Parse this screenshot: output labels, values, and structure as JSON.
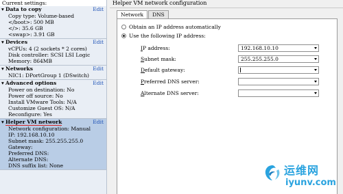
{
  "left_panel": {
    "header": "Current settings:",
    "edit_label": "Edit",
    "sections": [
      {
        "title": "Data to copy",
        "lines": [
          "Copy type: Volume-based",
          "</boot>: 500 MB",
          "</>: 35.6 GB",
          "<swap>: 3.91 GB"
        ]
      },
      {
        "title": "Devices",
        "lines": [
          "vCPUs: 4 (2 sockets * 2 cores)",
          "Disk controller: SCSI LSI Logic",
          "Memory: 864MB"
        ]
      },
      {
        "title": "Networks",
        "lines": [
          "NIC1: DPortGroup 1 (DSwitch)"
        ]
      },
      {
        "title": "Advanced options",
        "lines": [
          "Power on destination: No",
          "Power off source: No",
          "Install VMware Tools: N/A",
          "Customize Guest OS: N/A",
          "Reconfigure: Yes"
        ]
      },
      {
        "title": "Helper VM network",
        "lines": [
          "Network configuration: Manual",
          "IP: 192.168.10.10",
          "Subnet mask: 255.255.255.0",
          "Gateway:",
          "Preferred DNS:",
          "Alternate DNS:",
          "DNS suffix list: None"
        ]
      }
    ]
  },
  "right_panel": {
    "title": "Helper VM network configuration",
    "tabs": [
      "Network",
      "DNS"
    ],
    "radio_auto": "Obtain an IP address automatically",
    "radio_manual": "Use the following IP address:",
    "fields": [
      {
        "key": "I",
        "rest": "P address:",
        "value": "192.168.10.10"
      },
      {
        "key": "S",
        "rest": "ubnet mask:",
        "value": "255.255.255.0"
      },
      {
        "key": "D",
        "rest": "efault gateway:",
        "value": ""
      },
      {
        "key": "P",
        "rest": "referred DNS server:",
        "value": ""
      },
      {
        "key": "A",
        "rest": "lternate DNS server:",
        "value": ""
      }
    ]
  },
  "watermark": {
    "chinese": "运维网",
    "domain": "iyunv.com"
  },
  "colors": {
    "link": "#1a4fb5",
    "selected_section": "#b9cde6",
    "watermark": "#2aa3df",
    "highlight_underline": "#d41f1f"
  }
}
